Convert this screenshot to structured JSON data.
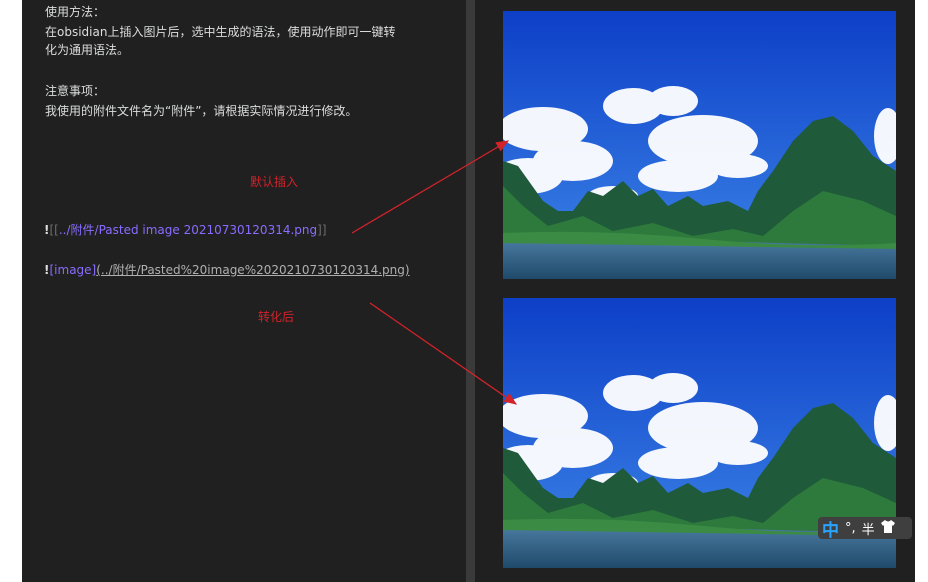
{
  "usage": {
    "heading": "使用方法：",
    "line1": "在obsidian上插入图片后，选中生成的语法，使用动作即可一键转",
    "line2": "化为通用语法。"
  },
  "notes": {
    "heading": "注意事项：",
    "line1": "我使用的附件文件名为“附件”，请根据实际情况进行修改。"
  },
  "annotations": {
    "default_insert": "默认插入",
    "converted": "转化后"
  },
  "wikilink": {
    "bang": "!",
    "open": "[[",
    "path": "../附件/Pasted image 20210730120314.png",
    "close": "]]"
  },
  "mdlink": {
    "bang": "!",
    "alt": "[image]",
    "url": "(../附件/Pasted%20image%2020210730120314.png)"
  },
  "ime": {
    "mode": "中",
    "punct": "°,",
    "width": "半",
    "skin_icon": "shirt-icon"
  },
  "colors": {
    "background": "#202020",
    "link": "#8a6cff",
    "annotation": "#d2232a"
  }
}
